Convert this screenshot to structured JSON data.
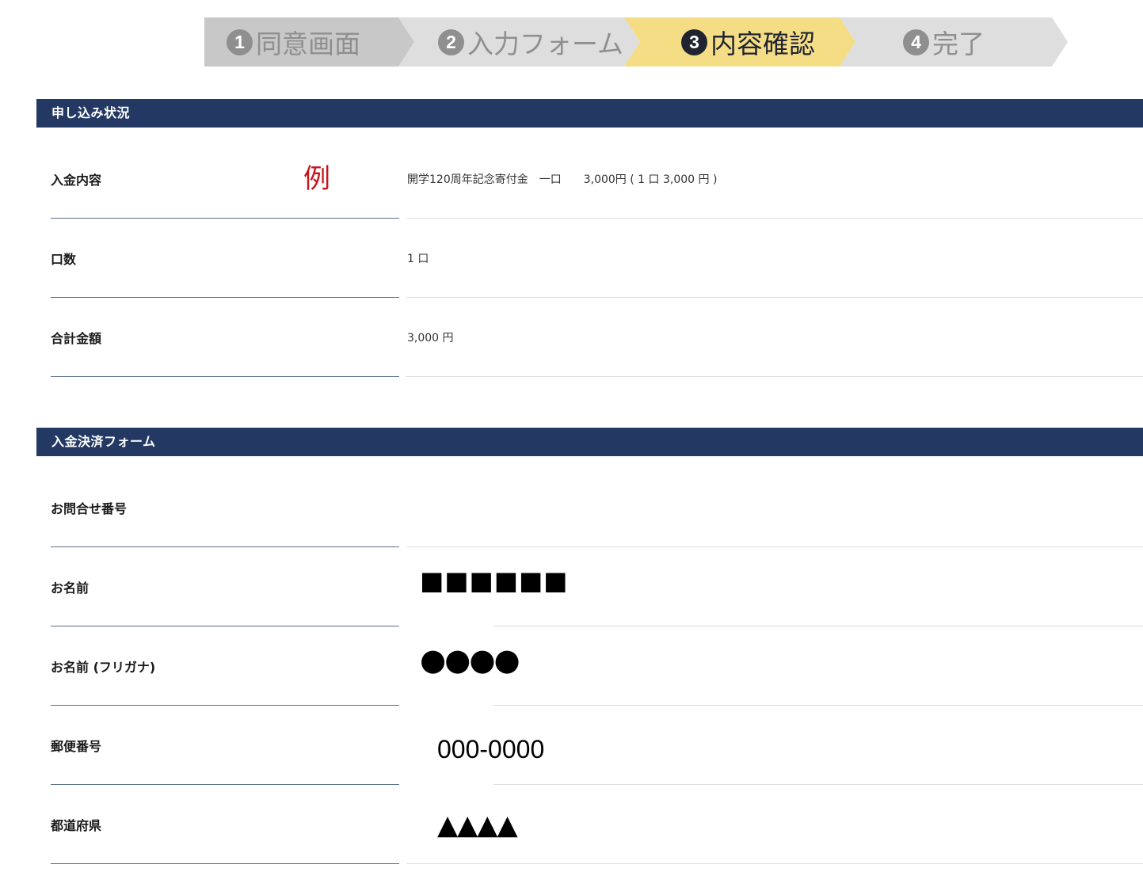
{
  "steps": [
    {
      "num": "1",
      "label": "同意画面",
      "active": false
    },
    {
      "num": "2",
      "label": "入力フォーム",
      "active": false
    },
    {
      "num": "3",
      "label": "内容確認",
      "active": true
    },
    {
      "num": "4",
      "label": "完了",
      "active": false
    }
  ],
  "colors": {
    "step_inactive": "#dedede",
    "step_done": "#c8c8c8",
    "step_active": "#f5dd86",
    "section_bar": "#233863",
    "example_mark": "#c8141b"
  },
  "section1": {
    "title": "申し込み状況",
    "example_mark": "例",
    "rows": [
      {
        "label": "入金内容",
        "value": "開学120周年記念寄付金　一口　　3,000円 ( 1 口 3,000 円 )"
      },
      {
        "label": "口数",
        "value": "1 口"
      },
      {
        "label": "合計金額",
        "value": "3,000 円"
      }
    ]
  },
  "section2": {
    "title": "入金決済フォーム",
    "rows": [
      {
        "label": "お問合せ番号",
        "value": ""
      },
      {
        "label": "お名前",
        "value": "■■■■■■"
      },
      {
        "label": "お名前 (フリガナ)",
        "value": "●●●●"
      },
      {
        "label": "郵便番号",
        "value": "000-0000"
      },
      {
        "label": "都道府県",
        "value": "▲▲▲▲"
      }
    ]
  }
}
